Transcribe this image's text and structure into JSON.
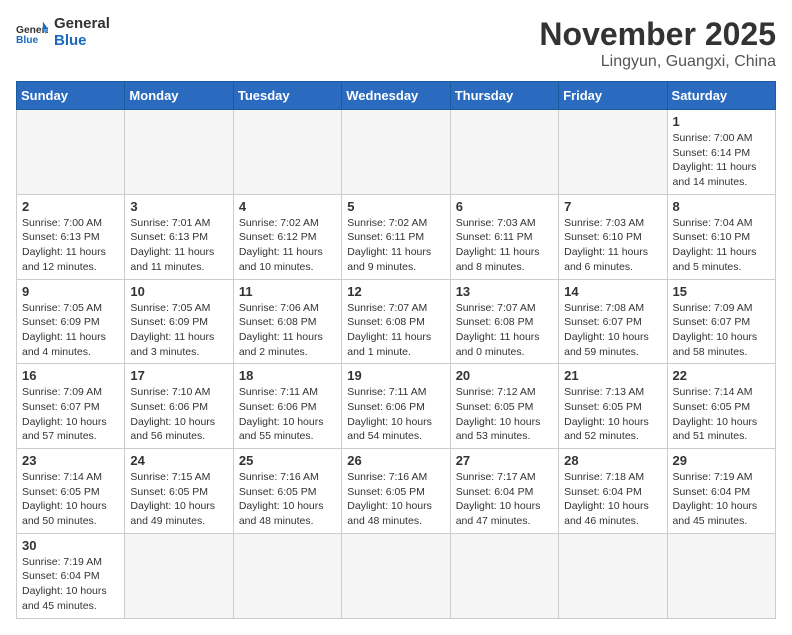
{
  "header": {
    "logo_general": "General",
    "logo_blue": "Blue",
    "month_title": "November 2025",
    "location": "Lingyun, Guangxi, China"
  },
  "weekdays": [
    "Sunday",
    "Monday",
    "Tuesday",
    "Wednesday",
    "Thursday",
    "Friday",
    "Saturday"
  ],
  "weeks": [
    [
      {
        "day": "",
        "info": ""
      },
      {
        "day": "",
        "info": ""
      },
      {
        "day": "",
        "info": ""
      },
      {
        "day": "",
        "info": ""
      },
      {
        "day": "",
        "info": ""
      },
      {
        "day": "",
        "info": ""
      },
      {
        "day": "1",
        "info": "Sunrise: 7:00 AM\nSunset: 6:14 PM\nDaylight: 11 hours\nand 14 minutes."
      }
    ],
    [
      {
        "day": "2",
        "info": "Sunrise: 7:00 AM\nSunset: 6:13 PM\nDaylight: 11 hours\nand 12 minutes."
      },
      {
        "day": "3",
        "info": "Sunrise: 7:01 AM\nSunset: 6:13 PM\nDaylight: 11 hours\nand 11 minutes."
      },
      {
        "day": "4",
        "info": "Sunrise: 7:02 AM\nSunset: 6:12 PM\nDaylight: 11 hours\nand 10 minutes."
      },
      {
        "day": "5",
        "info": "Sunrise: 7:02 AM\nSunset: 6:11 PM\nDaylight: 11 hours\nand 9 minutes."
      },
      {
        "day": "6",
        "info": "Sunrise: 7:03 AM\nSunset: 6:11 PM\nDaylight: 11 hours\nand 8 minutes."
      },
      {
        "day": "7",
        "info": "Sunrise: 7:03 AM\nSunset: 6:10 PM\nDaylight: 11 hours\nand 6 minutes."
      },
      {
        "day": "8",
        "info": "Sunrise: 7:04 AM\nSunset: 6:10 PM\nDaylight: 11 hours\nand 5 minutes."
      }
    ],
    [
      {
        "day": "9",
        "info": "Sunrise: 7:05 AM\nSunset: 6:09 PM\nDaylight: 11 hours\nand 4 minutes."
      },
      {
        "day": "10",
        "info": "Sunrise: 7:05 AM\nSunset: 6:09 PM\nDaylight: 11 hours\nand 3 minutes."
      },
      {
        "day": "11",
        "info": "Sunrise: 7:06 AM\nSunset: 6:08 PM\nDaylight: 11 hours\nand 2 minutes."
      },
      {
        "day": "12",
        "info": "Sunrise: 7:07 AM\nSunset: 6:08 PM\nDaylight: 11 hours\nand 1 minute."
      },
      {
        "day": "13",
        "info": "Sunrise: 7:07 AM\nSunset: 6:08 PM\nDaylight: 11 hours\nand 0 minutes."
      },
      {
        "day": "14",
        "info": "Sunrise: 7:08 AM\nSunset: 6:07 PM\nDaylight: 10 hours\nand 59 minutes."
      },
      {
        "day": "15",
        "info": "Sunrise: 7:09 AM\nSunset: 6:07 PM\nDaylight: 10 hours\nand 58 minutes."
      }
    ],
    [
      {
        "day": "16",
        "info": "Sunrise: 7:09 AM\nSunset: 6:07 PM\nDaylight: 10 hours\nand 57 minutes."
      },
      {
        "day": "17",
        "info": "Sunrise: 7:10 AM\nSunset: 6:06 PM\nDaylight: 10 hours\nand 56 minutes."
      },
      {
        "day": "18",
        "info": "Sunrise: 7:11 AM\nSunset: 6:06 PM\nDaylight: 10 hours\nand 55 minutes."
      },
      {
        "day": "19",
        "info": "Sunrise: 7:11 AM\nSunset: 6:06 PM\nDaylight: 10 hours\nand 54 minutes."
      },
      {
        "day": "20",
        "info": "Sunrise: 7:12 AM\nSunset: 6:05 PM\nDaylight: 10 hours\nand 53 minutes."
      },
      {
        "day": "21",
        "info": "Sunrise: 7:13 AM\nSunset: 6:05 PM\nDaylight: 10 hours\nand 52 minutes."
      },
      {
        "day": "22",
        "info": "Sunrise: 7:14 AM\nSunset: 6:05 PM\nDaylight: 10 hours\nand 51 minutes."
      }
    ],
    [
      {
        "day": "23",
        "info": "Sunrise: 7:14 AM\nSunset: 6:05 PM\nDaylight: 10 hours\nand 50 minutes."
      },
      {
        "day": "24",
        "info": "Sunrise: 7:15 AM\nSunset: 6:05 PM\nDaylight: 10 hours\nand 49 minutes."
      },
      {
        "day": "25",
        "info": "Sunrise: 7:16 AM\nSunset: 6:05 PM\nDaylight: 10 hours\nand 48 minutes."
      },
      {
        "day": "26",
        "info": "Sunrise: 7:16 AM\nSunset: 6:05 PM\nDaylight: 10 hours\nand 48 minutes."
      },
      {
        "day": "27",
        "info": "Sunrise: 7:17 AM\nSunset: 6:04 PM\nDaylight: 10 hours\nand 47 minutes."
      },
      {
        "day": "28",
        "info": "Sunrise: 7:18 AM\nSunset: 6:04 PM\nDaylight: 10 hours\nand 46 minutes."
      },
      {
        "day": "29",
        "info": "Sunrise: 7:19 AM\nSunset: 6:04 PM\nDaylight: 10 hours\nand 45 minutes."
      }
    ],
    [
      {
        "day": "30",
        "info": "Sunrise: 7:19 AM\nSunset: 6:04 PM\nDaylight: 10 hours\nand 45 minutes."
      },
      {
        "day": "",
        "info": ""
      },
      {
        "day": "",
        "info": ""
      },
      {
        "day": "",
        "info": ""
      },
      {
        "day": "",
        "info": ""
      },
      {
        "day": "",
        "info": ""
      },
      {
        "day": "",
        "info": ""
      }
    ]
  ]
}
